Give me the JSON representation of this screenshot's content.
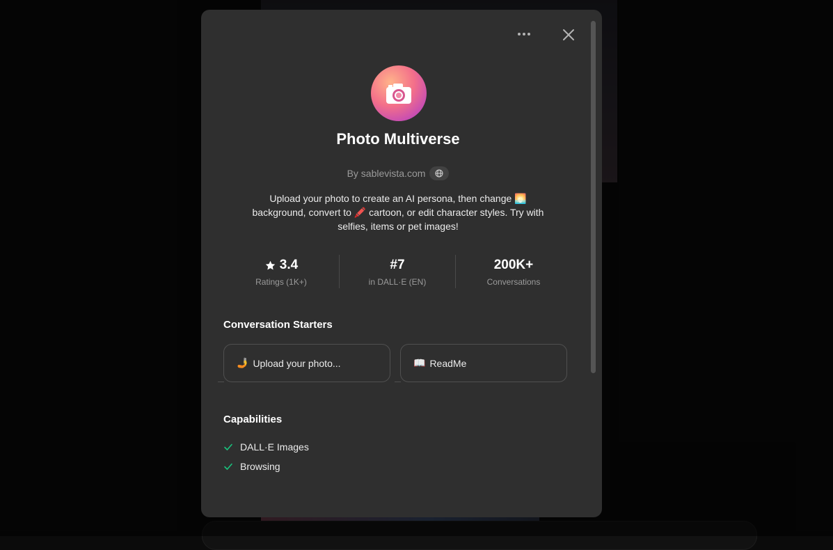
{
  "gpt": {
    "name": "Photo Multiverse",
    "author": "By sablevista.com",
    "description_parts": [
      "Upload your photo to create an AI persona, then change ",
      "🌅",
      " background, convert to ",
      "🖍️",
      " cartoon, or edit character styles. Try with selfies, items or pet images!"
    ]
  },
  "stats": [
    {
      "value": "3.4",
      "label": "Ratings (1K+)",
      "icon": "star-icon"
    },
    {
      "value": "#7",
      "label": "in DALL·E (EN)"
    },
    {
      "value": "200K+",
      "label": "Conversations"
    }
  ],
  "starters": {
    "title": "Conversation Starters",
    "items": [
      {
        "emoji": "🤳",
        "label": "Upload your photo..."
      },
      {
        "emoji": "📖",
        "label": "ReadMe"
      }
    ]
  },
  "capabilities": {
    "title": "Capabilities",
    "items": [
      {
        "label": "DALL·E Images"
      },
      {
        "label": "Browsing"
      }
    ]
  },
  "colors": {
    "modal_bg": "#2f2f2f",
    "check": "#19c37d"
  }
}
